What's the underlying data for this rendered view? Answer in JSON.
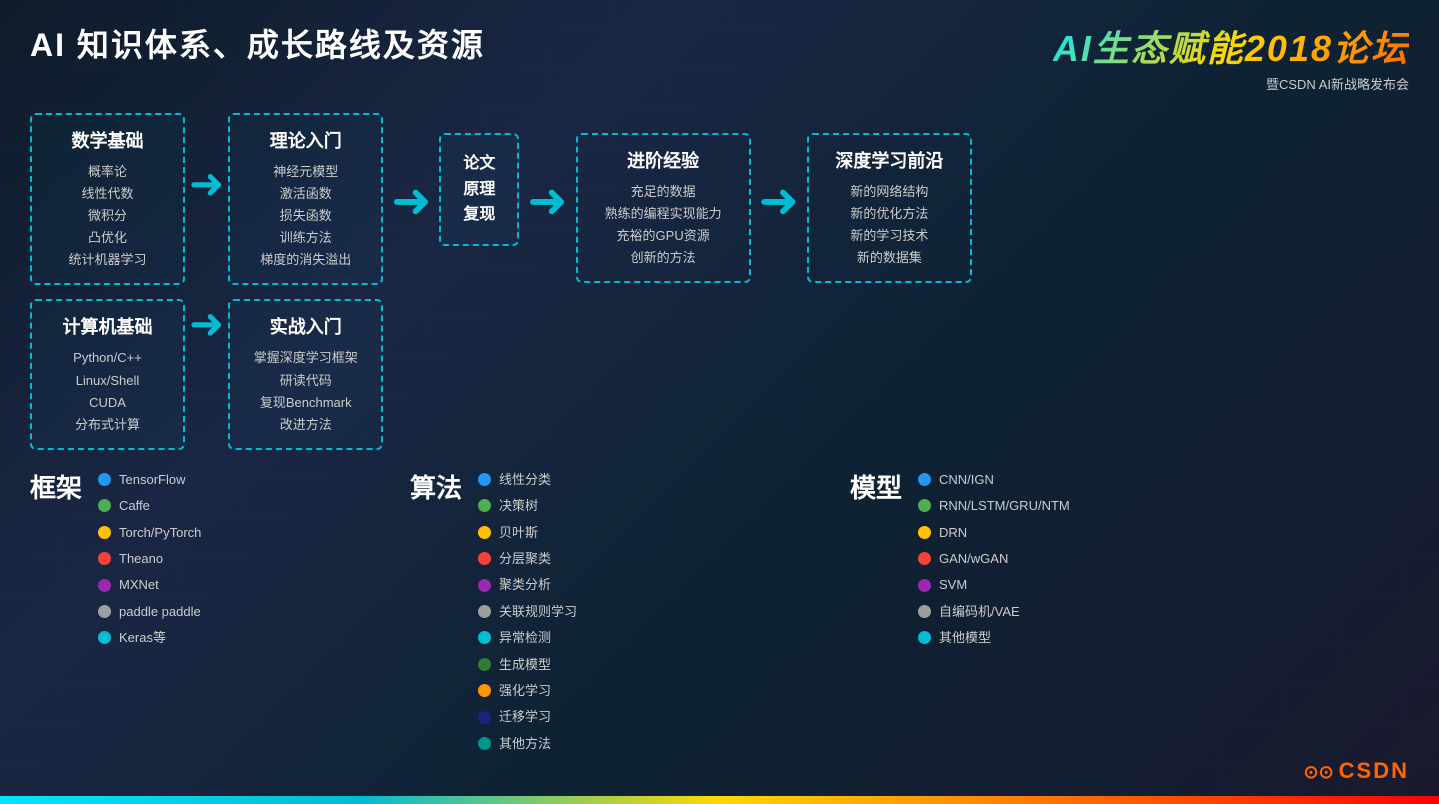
{
  "header": {
    "title": "AI 知识体系、成长路线及资源",
    "logo": {
      "main": "AI生态赋能2018论坛",
      "sub": "暨CSDN AI新战略发布会"
    }
  },
  "math_box": {
    "title": "数学基础",
    "items": [
      "概率论",
      "线性代数",
      "微积分",
      "凸优化",
      "统计机器学习"
    ]
  },
  "computer_box": {
    "title": "计算机基础",
    "items": [
      "Python/C++",
      "Linux/Shell",
      "CUDA",
      "分布式计算"
    ]
  },
  "theory_box": {
    "title": "理论入门",
    "items": [
      "神经元模型",
      "激活函数",
      "损失函数",
      "训练方法",
      "梯度的消失溢出"
    ]
  },
  "practice_box": {
    "title": "实战入门",
    "items": [
      "掌握深度学习框架",
      "研读代码",
      "复现Benchmark",
      "改进方法"
    ]
  },
  "paper_box": {
    "lines": [
      "论文",
      "原理",
      "复现"
    ]
  },
  "adv_box": {
    "title": "进阶经验",
    "items": [
      "充足的数据",
      "熟练的编程实现能力",
      "充裕的GPU资源",
      "创新的方法"
    ]
  },
  "deep_box": {
    "title": "深度学习前沿",
    "items": [
      "新的网络结构",
      "新的优化方法",
      "新的学习技术",
      "新的数据集"
    ]
  },
  "frameworks": {
    "title": "框架",
    "items": [
      {
        "color": "blue",
        "name": "TensorFlow"
      },
      {
        "color": "green",
        "name": "Caffe"
      },
      {
        "color": "yellow",
        "name": "Torch/PyTorch"
      },
      {
        "color": "red",
        "name": "Theano"
      },
      {
        "color": "purple",
        "name": "MXNet"
      },
      {
        "color": "gray",
        "name": "paddle paddle"
      },
      {
        "color": "cyan",
        "name": "Keras等"
      }
    ]
  },
  "algorithms": {
    "title": "算法",
    "items": [
      {
        "color": "blue",
        "name": "线性分类"
      },
      {
        "color": "green",
        "name": "决策树"
      },
      {
        "color": "yellow",
        "name": "贝叶斯"
      },
      {
        "color": "red",
        "name": "分层聚类"
      },
      {
        "color": "purple",
        "name": "聚类分析"
      },
      {
        "color": "gray",
        "name": "关联规则学习"
      },
      {
        "color": "cyan",
        "name": "异常检测"
      },
      {
        "color": "dark-green",
        "name": "生成模型"
      },
      {
        "color": "orange",
        "name": "强化学习"
      },
      {
        "color": "dark-blue",
        "name": "迁移学习"
      },
      {
        "color": "teal",
        "name": "其他方法"
      }
    ]
  },
  "models": {
    "title": "模型",
    "items": [
      {
        "color": "blue",
        "name": "CNN/IGN"
      },
      {
        "color": "green",
        "name": "RNN/LSTM/GRU/NTM"
      },
      {
        "color": "yellow",
        "name": "DRN"
      },
      {
        "color": "red",
        "name": "GAN/wGAN"
      },
      {
        "color": "purple",
        "name": "SVM"
      },
      {
        "color": "gray",
        "name": "自编码机/VAE"
      },
      {
        "color": "cyan",
        "name": "其他模型"
      }
    ]
  },
  "csdn": {
    "label": "CSDN"
  }
}
